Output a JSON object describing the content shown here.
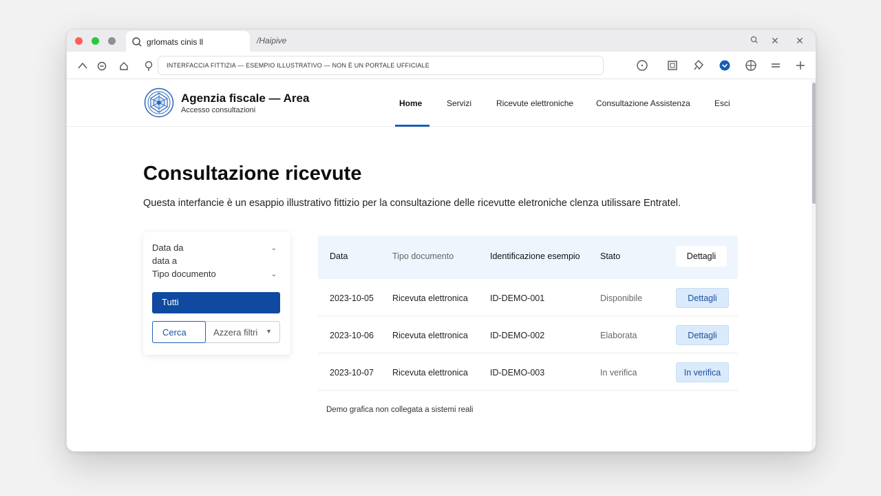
{
  "browser": {
    "active_tab_title": "grlomats cinis ll",
    "inactive_tab_title": "/Haipive",
    "address_text": "INTERFACCIA FITTIZIA — ESEMPIO ILLUSTRATIVO — NON È UN PORTALE UFFICIALE"
  },
  "header": {
    "brand_title": "Agenzia fiscale — Area",
    "brand_subtitle": "Accesso consultazioni",
    "nav": [
      "Home",
      "Servizi",
      "Ricevute elettroniche",
      "Consultazione Assistenza",
      "Esci"
    ]
  },
  "main": {
    "title": "Consultazione ricevute",
    "description": "Questa interfancie è un esappio illustrativo fittizio per la consultazione delle ricevutte eletroniche clenza utilissare Entratel."
  },
  "filters": {
    "date_from_label": "Data da",
    "date_to_label": "data a",
    "doc_type_label": "Tipo documento",
    "all_button": "Tutti",
    "search_button": "Cerca",
    "reset_button": "Azzera filtri"
  },
  "table": {
    "headers": [
      "Data",
      "Tipo documento",
      "Identificazione esempio",
      "Stato",
      "Dettagli"
    ],
    "rows": [
      {
        "date": "2023-10-05",
        "type": "Ricevuta elettronica",
        "id": "ID-DEMO-001",
        "status": "Disponibile",
        "action": "Dettagli"
      },
      {
        "date": "2023-10-06",
        "type": "Ricevuta elettronica",
        "id": "ID-DEMO-002",
        "status": "Elaborata",
        "action": "Dettagli"
      },
      {
        "date": "2023-10-07",
        "type": "Ricevuta elettronica",
        "id": "ID-DEMO-003",
        "status": "In verifica",
        "action": "In verifica"
      }
    ]
  },
  "footer_note": "Demo grafica non collegata a sistemi reali",
  "colors": {
    "primary": "#0f4aa0",
    "accent_blue": "#1a5fb4",
    "table_header_bg": "#eef5fd",
    "action_button_bg": "#dbeafb"
  }
}
